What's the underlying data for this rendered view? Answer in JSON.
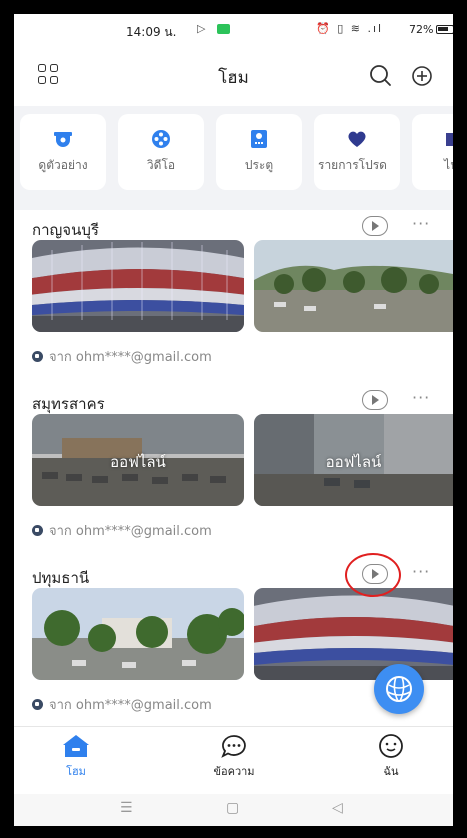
{
  "status_bar": {
    "time": "14:09 น.",
    "battery": "72%",
    "icons": [
      "play-indicator-icon",
      "message-indicator-icon",
      "alarm-icon",
      "vibrate-icon",
      "wifi-icon",
      "signal-icon",
      "battery-icon"
    ]
  },
  "header": {
    "title": "โฮม",
    "left_icon": "grid-menu-icon",
    "right_icons": [
      "search-icon",
      "add-circle-icon"
    ]
  },
  "shortcuts": [
    {
      "label": "ดูตัวอย่าง",
      "icon": "camera-dome-icon",
      "color": "#2f80ed"
    },
    {
      "label": "วิดีโอ",
      "icon": "video-reel-icon",
      "color": "#2f80ed"
    },
    {
      "label": "ประตู",
      "icon": "door-lock-icon",
      "color": "#2f80ed"
    },
    {
      "label": "รายการโปรด",
      "icon": "heart-icon",
      "color": "#2f3a8f"
    },
    {
      "label": "ไฟล์",
      "icon": "folder-icon",
      "color": "#3a3f8f"
    }
  ],
  "groups": [
    {
      "title": "กาญจนบุรี",
      "shared_by": "จาก ohm****@gmail.com",
      "thumbs": [
        {
          "offline": ""
        },
        {
          "offline": ""
        }
      ]
    },
    {
      "title": "สมุทรสาคร",
      "shared_by": "จาก ohm****@gmail.com",
      "thumbs": [
        {
          "offline": "ออฟไลน์"
        },
        {
          "offline": "ออฟไลน์"
        }
      ]
    },
    {
      "title": "ปทุมธานี",
      "shared_by": "จาก ohm****@gmail.com",
      "thumbs": [
        {
          "offline": ""
        },
        {
          "offline": ""
        }
      ]
    }
  ],
  "bottom_nav": [
    {
      "label": "โฮม",
      "icon": "home-icon",
      "active": true
    },
    {
      "label": "ข้อความ",
      "icon": "message-bubble-icon",
      "active": false
    },
    {
      "label": "ฉัน",
      "icon": "profile-smile-icon",
      "active": false
    }
  ],
  "system_nav": [
    "menu-icon",
    "home-square-icon",
    "back-triangle-icon"
  ],
  "colors": {
    "accent": "#2f80ed",
    "background": "#f2f3f6",
    "annotation": "#e02020"
  }
}
